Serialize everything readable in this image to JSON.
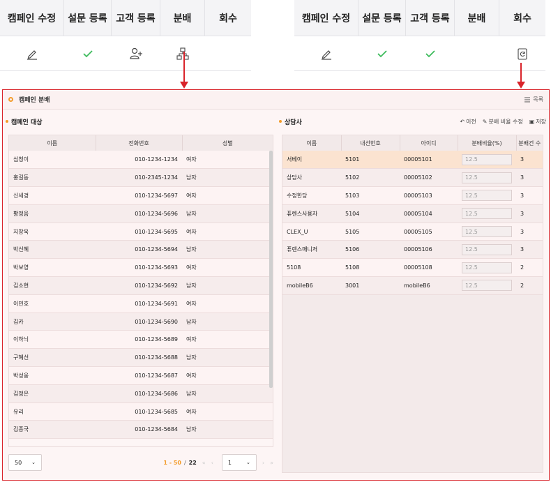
{
  "colors": {
    "accent": "#d9242b",
    "orange": "#f39c2b",
    "check": "#3dbb5c"
  },
  "topbar_left": {
    "headers": [
      "캠페인 수정",
      "설문 등록",
      "고객 등록",
      "분배",
      "회수"
    ],
    "icons": [
      "pencil-icon",
      "check-icon",
      "add-user-icon",
      "hierarchy-icon",
      ""
    ]
  },
  "topbar_right": {
    "headers": [
      "캠페인 수정",
      "설문 등록",
      "고객 등록",
      "분배",
      "회수"
    ],
    "icons": [
      "pencil-icon",
      "check-icon",
      "check-icon",
      "",
      "retrieve-icon"
    ]
  },
  "panel": {
    "title": "캠페인 분배",
    "list_label": "목록"
  },
  "left": {
    "title": "캠페인 대상",
    "columns": [
      "이름",
      "전화번호",
      "성별"
    ],
    "rows": [
      [
        "심청이",
        "010-1234-1234",
        "여자"
      ],
      [
        "홍길동",
        "010-2345-1234",
        "남자"
      ],
      [
        "신세경",
        "010-1234-5697",
        "여자"
      ],
      [
        "황정음",
        "010-1234-5696",
        "남자"
      ],
      [
        "지창욱",
        "010-1234-5695",
        "여자"
      ],
      [
        "박신혜",
        "010-1234-5694",
        "남자"
      ],
      [
        "박보영",
        "010-1234-5693",
        "여자"
      ],
      [
        "김소현",
        "010-1234-5692",
        "남자"
      ],
      [
        "이민호",
        "010-1234-5691",
        "여자"
      ],
      [
        "김카",
        "010-1234-5690",
        "남자"
      ],
      [
        "이하늬",
        "010-1234-5689",
        "여자"
      ],
      [
        "구혜선",
        "010-1234-5688",
        "남자"
      ],
      [
        "박성웅",
        "010-1234-5687",
        "여자"
      ],
      [
        "김정은",
        "010-1234-5686",
        "남자"
      ],
      [
        "유리",
        "010-1234-5685",
        "여자"
      ],
      [
        "김종국",
        "010-1234-5684",
        "남자"
      ]
    ],
    "page_size": "50",
    "range": "1 - 50",
    "sep": "/",
    "total": "22",
    "page": "1"
  },
  "right": {
    "title": "상담사",
    "tool_prev": "이전",
    "tool_edit": "분배 비율 수정",
    "tool_save": "저장",
    "columns": [
      "이름",
      "내선번호",
      "아이디",
      "분배비율(%)",
      "분배건 수"
    ],
    "rows": [
      [
        "서베이",
        "5101",
        "00005101",
        "12.5",
        "3"
      ],
      [
        "상담사",
        "5102",
        "00005102",
        "12.5",
        "3"
      ],
      [
        "수정한당",
        "5103",
        "00005103",
        "12.5",
        "3"
      ],
      [
        "퓨렌스사용자",
        "5104",
        "00005104",
        "12.5",
        "3"
      ],
      [
        "CLEX_U",
        "5105",
        "00005105",
        "12.5",
        "3"
      ],
      [
        "퓨렌스매니저",
        "5106",
        "00005106",
        "12.5",
        "3"
      ],
      [
        "5108",
        "5108",
        "00005108",
        "12.5",
        "2"
      ],
      [
        "mobileB6",
        "3001",
        "mobileB6",
        "12.5",
        "2"
      ]
    ]
  }
}
